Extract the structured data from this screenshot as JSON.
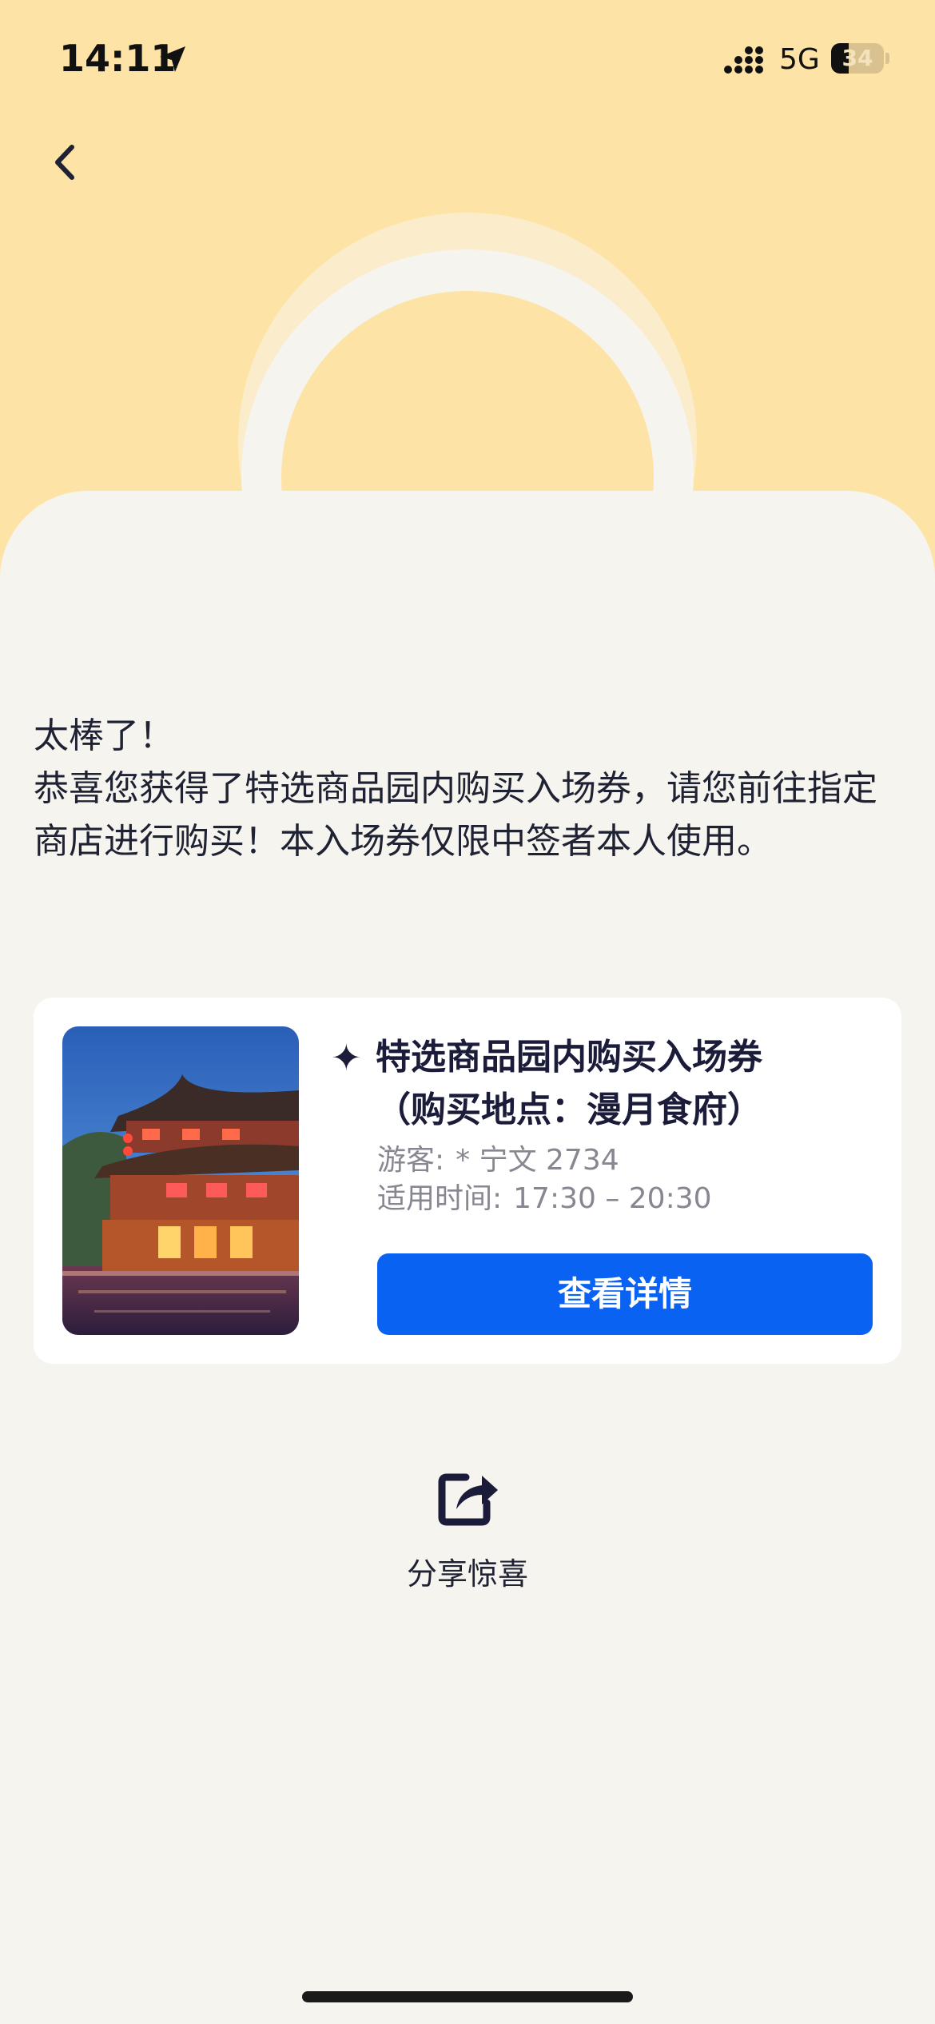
{
  "status_bar": {
    "time": "14:11",
    "network": "5G",
    "battery_level": "34",
    "battery_fraction": 0.34
  },
  "nav": {
    "back_icon": "chevron-left-icon"
  },
  "message": {
    "line1": "太棒了！",
    "line2": "恭喜您获得了特选商品园内购买入场券，请您前往指定商店进行购买！本入场券仅限中签者本人使用。"
  },
  "ticket": {
    "title": "特选商品园内购买入场券",
    "location": "（购买地点：漫月食府）",
    "visitor_label": "游客:",
    "visitor_value": "* 宁文 2734",
    "time_label": "适用时间:",
    "time_value": "17:30 – 20:30",
    "details_button": "查看详情",
    "icon": "sparkle-icon"
  },
  "share": {
    "label": "分享惊喜",
    "icon": "share-icon"
  },
  "colors": {
    "top_background": "#fde3a6",
    "page_background": "#f6f4ee",
    "button_blue": "#0a62f2",
    "title_text": "#1a1c3a",
    "muted_text": "#868791"
  }
}
